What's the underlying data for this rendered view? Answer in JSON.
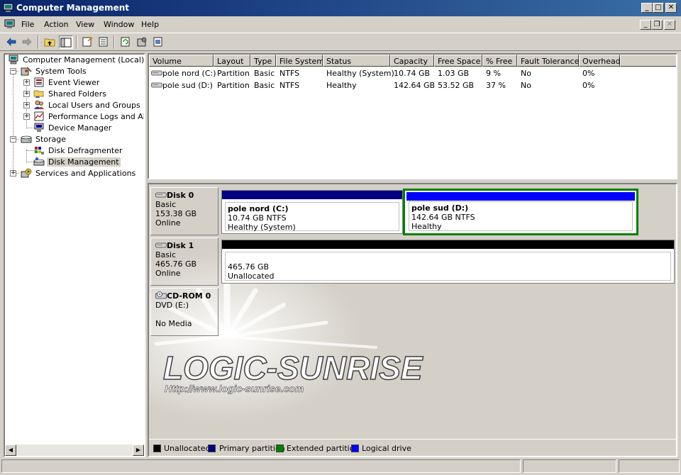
{
  "window": {
    "title": "Computer Management",
    "controls": {
      "minimize": "_",
      "maximize": "□",
      "close": "✕"
    }
  },
  "menu": {
    "items": [
      "File",
      "Action",
      "View",
      "Window",
      "Help"
    ],
    "mdi_controls": {
      "minimize": "_",
      "restore": "❐",
      "close": "✕"
    }
  },
  "toolbar": {
    "buttons": [
      "back-icon",
      "forward-icon",
      "up-folder-icon",
      "show-hide-tree-icon",
      "properties-icon",
      "export-list-icon",
      "refresh-icon",
      "settings-icon",
      "help-icon"
    ]
  },
  "tree": {
    "root": "Computer Management (Local)",
    "system_tools": "System Tools",
    "event_viewer": "Event Viewer",
    "shared_folders": "Shared Folders",
    "local_users": "Local Users and Groups",
    "perf_logs": "Performance Logs and Alerts",
    "device_manager": "Device Manager",
    "storage": "Storage",
    "disk_defrag": "Disk Defragmenter",
    "disk_mgmt": "Disk Management",
    "services": "Services and Applications",
    "expander_plus": "+",
    "expander_minus": "−"
  },
  "volumes": {
    "headers": [
      "Volume",
      "Layout",
      "Type",
      "File System",
      "Status",
      "Capacity",
      "Free Space",
      "% Free",
      "Fault Tolerance",
      "Overhead"
    ],
    "rows": [
      [
        "pole nord (C:)",
        "Partition",
        "Basic",
        "NTFS",
        "Healthy (System)",
        "10.74 GB",
        "1.03 GB",
        "9 %",
        "No",
        "0%"
      ],
      [
        "pole sud (D:)",
        "Partition",
        "Basic",
        "NTFS",
        "Healthy",
        "142.64 GB",
        "53.52 GB",
        "37 %",
        "No",
        "0%"
      ]
    ]
  },
  "disks": {
    "disk0": {
      "name": "Disk 0",
      "type": "Basic",
      "size": "153.38 GB",
      "status": "Online",
      "p1": {
        "title": "pole nord  (C:)",
        "size": "10.74 GB NTFS",
        "status": "Healthy (System)"
      },
      "p2": {
        "title": "pole sud  (D:)",
        "size": "142.64 GB NTFS",
        "status": "Healthy"
      }
    },
    "disk1": {
      "name": "Disk 1",
      "type": "Basic",
      "size": "465.76 GB",
      "status": "Online",
      "p1": {
        "size": "465.76 GB",
        "status": "Unallocated"
      }
    },
    "cdrom0": {
      "name": "CD-ROM 0",
      "drive": "DVD (E:)",
      "status": "No Media"
    }
  },
  "watermark": {
    "title": "LOGIC-SUNRISE",
    "url": "Http://www.logic-sunrise.com"
  },
  "legend": [
    {
      "label": "Unallocated",
      "color": "#000000"
    },
    {
      "label": "Primary partition",
      "color": "#000080"
    },
    {
      "label": "Extended partition",
      "color": "#008000"
    },
    {
      "label": "Logical drive",
      "color": "#0000ff"
    }
  ],
  "colors": {
    "titlebar_start": "#0a246a",
    "primary": "#000080",
    "logical": "#0000ff",
    "extended": "#008000",
    "unallocated": "#000000"
  }
}
